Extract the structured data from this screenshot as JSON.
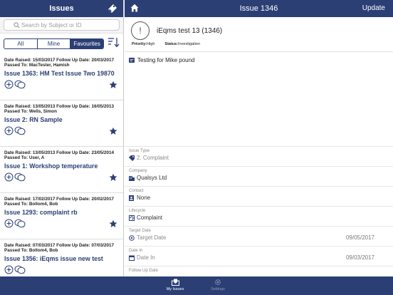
{
  "sidebar": {
    "title": "Issues",
    "search_placeholder": "Search by Subject or ID",
    "segments": [
      "All",
      "Mine",
      "Favourites"
    ],
    "items": [
      {
        "dates": "Date Raised: 15/03/2017   Follow Up Date: 20/03/2017",
        "passed": "Passed To: MacTester, Hamish",
        "title": "Issue 1363: HM Test Issue Two 19870"
      },
      {
        "dates": "Date Raised: 13/05/2013   Follow Up Date: 16/05/2013",
        "passed": "Passed To: Wells, Simon",
        "title": "Issue 2: RN Sample"
      },
      {
        "dates": "Date Raised: 13/05/2013   Follow Up Date: 23/05/2014",
        "passed": "Passed To: User, A",
        "title": "Issue 1: Workshop temperature"
      },
      {
        "dates": "Date Raised: 17/02/2017   Follow Up Date: 20/02/2017",
        "passed": "Passed To: Bollom4, Bob",
        "title": "Issue 1293: complaint rb"
      },
      {
        "dates": "Date Raised: 07/03/2017   Follow Up Date: 07/03/2017",
        "passed": "Passed To: Bollom4, Bob",
        "title": "Issue 1356: iEqms issue new test"
      }
    ]
  },
  "main": {
    "title": "Issue 1346",
    "update_label": "Update",
    "issue_name": "iEqms test 13 (1346)",
    "status_symbol": "!",
    "priority_label": "Priority:",
    "priority_value": "High",
    "status_label": "Status:",
    "status_value": "Investigation",
    "description": "Testing for Mike pound",
    "fields": {
      "issue_type": {
        "label": "Issue Type",
        "value": "2. Complaint"
      },
      "company": {
        "label": "Company",
        "value": "Qualsys Ltd"
      },
      "contact": {
        "label": "Contact",
        "value": "None"
      },
      "lifecycle": {
        "label": "Lifecycle",
        "value": "Complaint"
      },
      "target_date": {
        "label": "Target Date",
        "value": "Target Date",
        "date": "09/05/2017"
      },
      "date_in": {
        "label": "Date In",
        "value": "Date In",
        "date": "09/03/2017"
      },
      "follow_up": {
        "label": "Follow Up Date"
      }
    }
  },
  "tabs": {
    "my_issues": "My Issues",
    "settings": "Settings"
  },
  "colors": {
    "brand": "#2b3f75"
  }
}
